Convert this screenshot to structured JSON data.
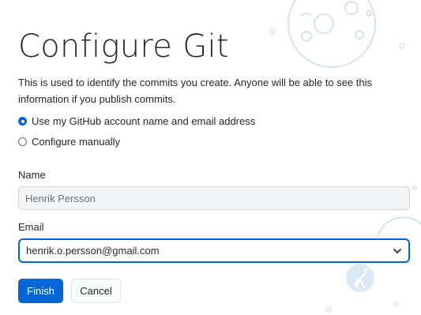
{
  "page": {
    "title": "Configure Git",
    "description": "This is used to identify the commits you create. Anyone will be able to see this information if you publish commits."
  },
  "identity_options": [
    {
      "label": "Use my GitHub account name and email address",
      "checked": true
    },
    {
      "label": "Configure manually",
      "checked": false
    }
  ],
  "form": {
    "name_label": "Name",
    "name_value": "Henrik Persson",
    "email_label": "Email",
    "email_value": "henrik.o.persson@gmail.com"
  },
  "buttons": {
    "finish": "Finish",
    "cancel": "Cancel"
  },
  "colors": {
    "accent": "#0366d6",
    "illustration": "#dbe9f5"
  },
  "icons": {
    "select_chevron": "chevron-down-icon",
    "background": "moon-illustration",
    "telescope": "telescope-icon"
  }
}
